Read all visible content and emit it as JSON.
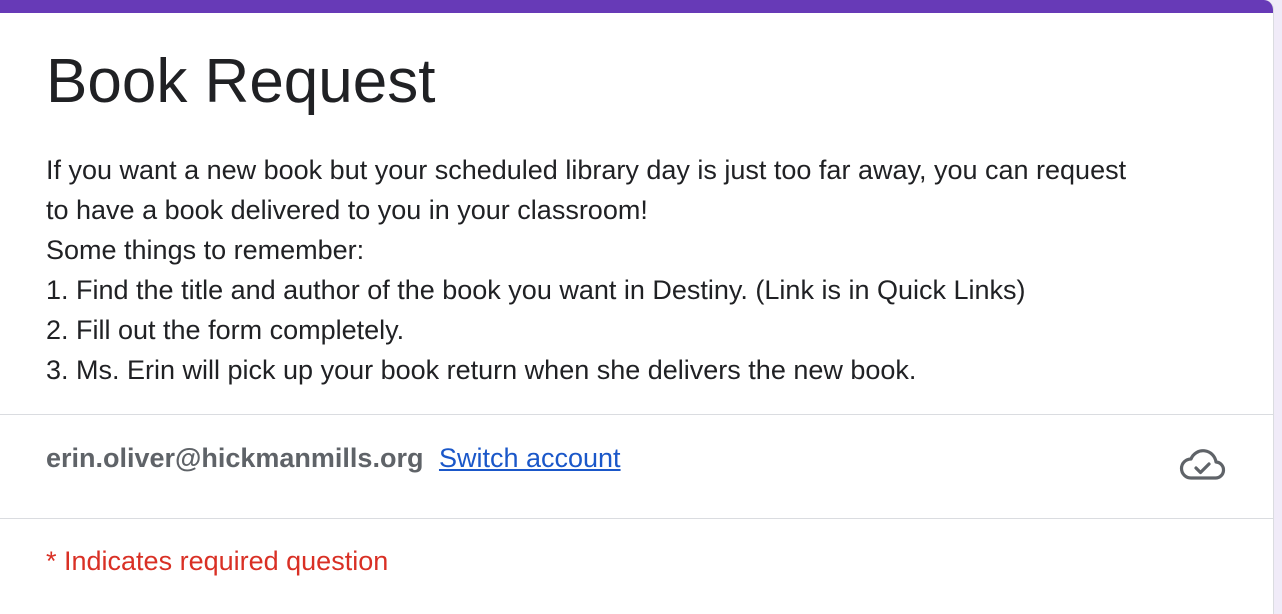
{
  "form": {
    "title": "Book Request",
    "description_lines": [
      "If you want a new book but your scheduled library day is just too far away, you can request",
      "to have a book delivered to you in your classroom!",
      "Some things to remember:",
      "1. Find the title and author of the book you want in Destiny. (Link is in Quick Links)",
      "2. Fill out the form completely.",
      "3. Ms. Erin will pick up your book return when she delivers the new book."
    ]
  },
  "account": {
    "email": "erin.oliver@hickmanmills.org",
    "switch_label": "Switch account",
    "status_icon": "cloud-done-icon"
  },
  "required_note": "* Indicates required question",
  "colors": {
    "accent": "#673ab7",
    "link": "#1a57c9",
    "required": "#d93025"
  }
}
